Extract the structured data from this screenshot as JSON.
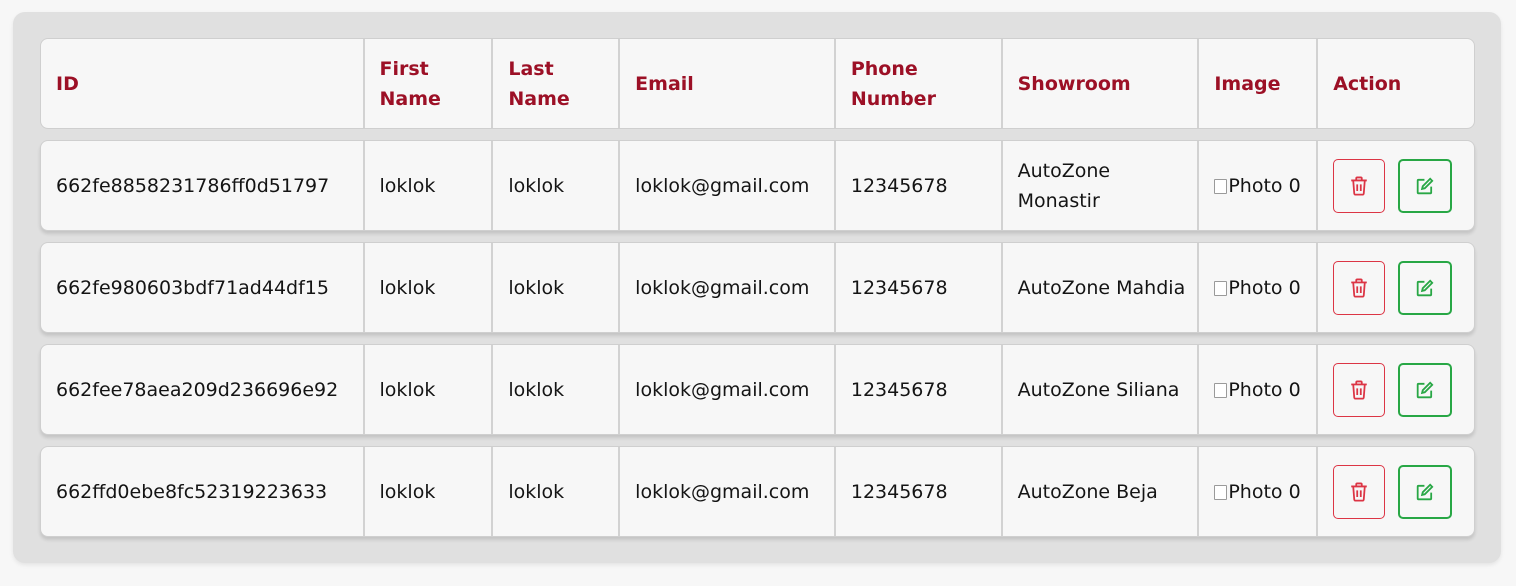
{
  "colors": {
    "header_text": "#9c1026",
    "delete": "#dc3545",
    "edit": "#28a745"
  },
  "table": {
    "headers": [
      "ID",
      "First Name",
      "Last Name",
      "Email",
      "Phone Number",
      "Showroom",
      "Image",
      "Action"
    ],
    "rows": [
      {
        "id": "662fe8858231786ff0d51797",
        "first_name": "loklok",
        "last_name": "loklok",
        "email": "loklok@gmail.com",
        "phone": "12345678",
        "showroom": "AutoZone Monastir",
        "image_alt": "Photo 0"
      },
      {
        "id": "662fe980603bdf71ad44df15",
        "first_name": "loklok",
        "last_name": "loklok",
        "email": "loklok@gmail.com",
        "phone": "12345678",
        "showroom": "AutoZone Mahdia",
        "image_alt": "Photo 0"
      },
      {
        "id": "662fee78aea209d236696e92",
        "first_name": "loklok",
        "last_name": "loklok",
        "email": "loklok@gmail.com",
        "phone": "12345678",
        "showroom": "AutoZone Siliana",
        "image_alt": "Photo 0"
      },
      {
        "id": "662ffd0ebe8fc52319223633",
        "first_name": "loklok",
        "last_name": "loklok",
        "email": "loklok@gmail.com",
        "phone": "12345678",
        "showroom": "AutoZone Beja",
        "image_alt": "Photo 0"
      }
    ],
    "actions": {
      "delete_icon": "trash-icon",
      "edit_icon": "pencil-square-icon"
    }
  }
}
